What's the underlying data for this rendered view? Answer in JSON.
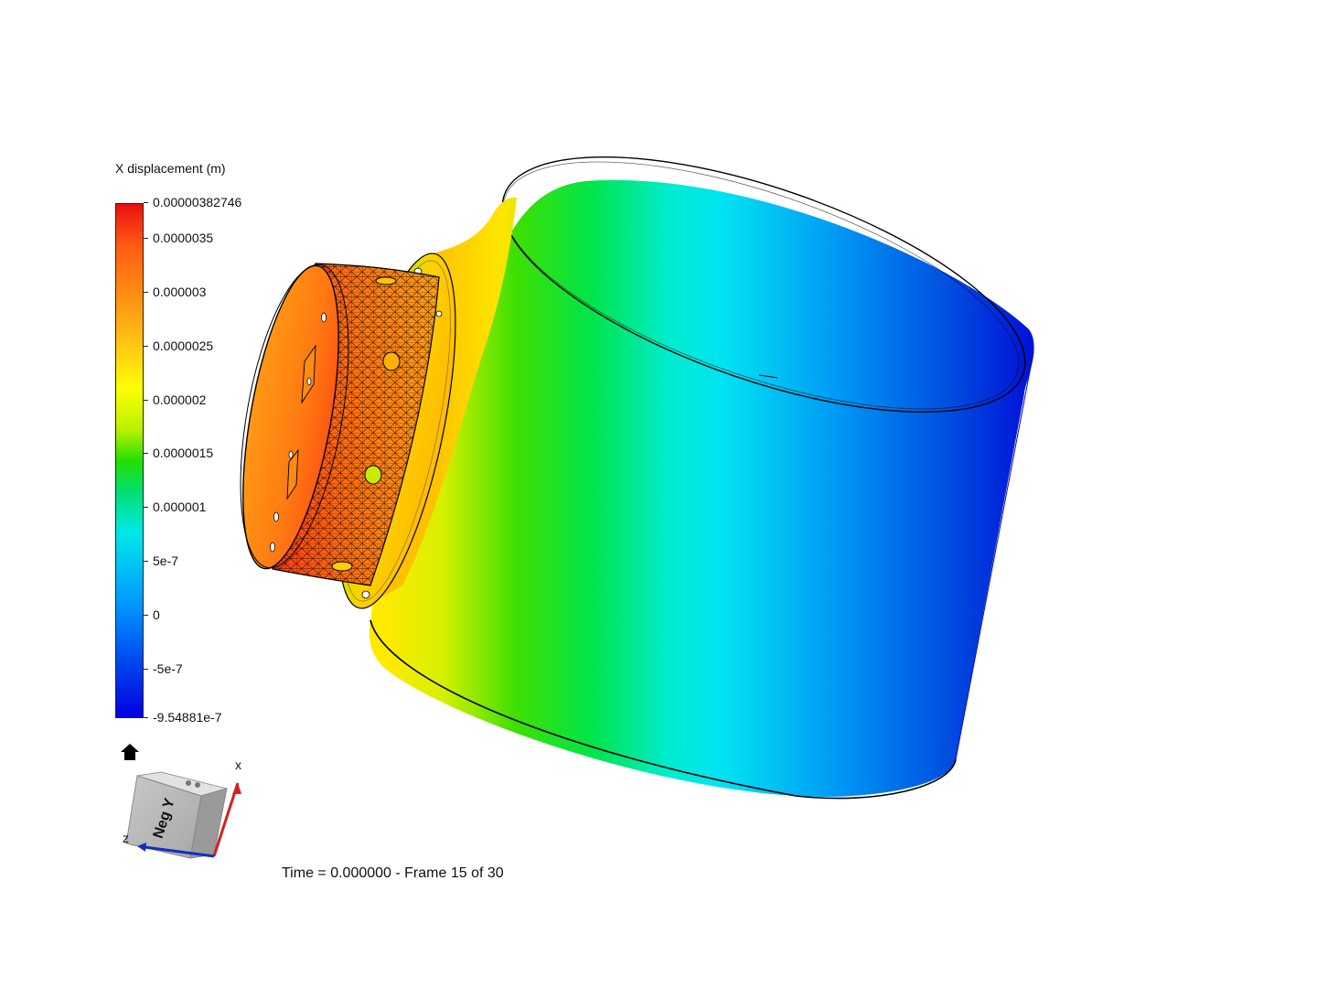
{
  "legend": {
    "title": "X displacement (m)",
    "ticks": [
      {
        "label": "0.00000382746",
        "value": 3.82746e-06
      },
      {
        "label": "0.0000035",
        "value": 3.5e-06
      },
      {
        "label": "0.000003",
        "value": 3e-06
      },
      {
        "label": "0.0000025",
        "value": 2.5e-06
      },
      {
        "label": "0.000002",
        "value": 2e-06
      },
      {
        "label": "0.0000015",
        "value": 1.5e-06
      },
      {
        "label": "0.000001",
        "value": 1e-06
      },
      {
        "label": "5e-7",
        "value": 5e-07
      },
      {
        "label": "0",
        "value": 0
      },
      {
        "label": "-5e-7",
        "value": -5e-07
      },
      {
        "label": "-9.54881e-7",
        "value": -9.54881e-07
      }
    ],
    "colors": [
      "#e81010",
      "#ff9a14",
      "#ffff00",
      "#24e000",
      "#00e8e8",
      "#0098ff",
      "#0000e0"
    ]
  },
  "viewcube": {
    "face_label": "Neg Y",
    "axis_x_label": "x",
    "axis_z_label": "z",
    "axis_x_color": "#d42020",
    "axis_z_color": "#1030c0"
  },
  "toolbar": {
    "home_icon": "home-icon"
  },
  "status": {
    "text": "Time = 0.000000 - Frame 15 of 30",
    "time": 0.0,
    "frame": 15,
    "frame_total": 30
  }
}
